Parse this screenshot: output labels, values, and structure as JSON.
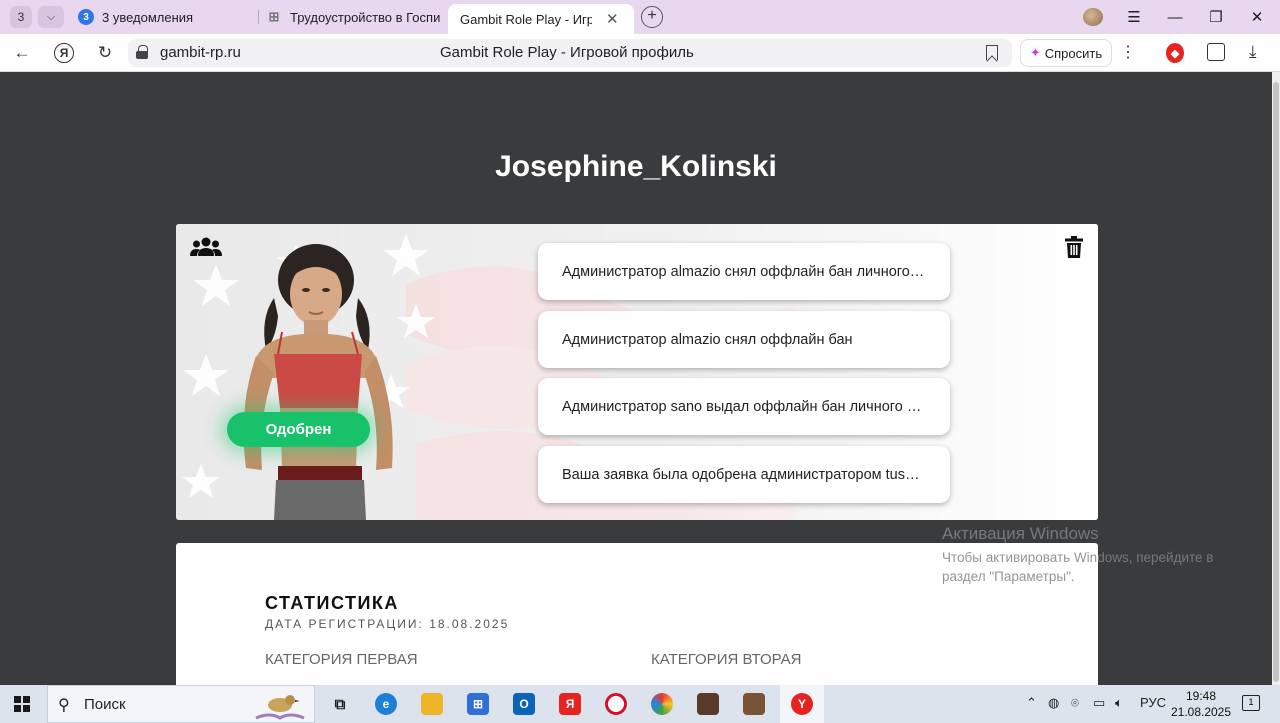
{
  "browser": {
    "tab_count": "3",
    "tabs": [
      {
        "label": "3 уведомления",
        "badge": "3"
      },
      {
        "label": "Трудоустройство в Госпи"
      },
      {
        "label": "Gambit Role Play - Игровой профиль"
      }
    ],
    "url": "gambit-rp.ru",
    "page_title": "Gambit Role Play - Игровой профиль",
    "ask_label": "Спросить"
  },
  "profile": {
    "username": "Josephine_Kolinski",
    "status": "Одобрен",
    "notifications": [
      "Администратор almazio снял оффлайн бан личного…",
      "Администратор almazio снял оффлайн бан",
      "Администратор sano выдал оффлайн бан личного …",
      "Ваша заявка была одобрена администратором tus…"
    ]
  },
  "stats": {
    "title": "СТАТИСТИКА",
    "registration": "ДАТА РЕГИСТРАЦИИ: 18.08.2025",
    "category_first": "КАТЕГОРИЯ ПЕРВАЯ",
    "category_second": "КАТЕГОРИЯ ВТОРАЯ"
  },
  "watermark": {
    "title": "Активация Windows",
    "text": "Чтобы активировать Windows, перейдите в раздел \"Параметры\"."
  },
  "taskbar": {
    "search_label": "Поиск",
    "language": "РУС",
    "time": "19:48",
    "date": "21.08.2025",
    "notification_count": "1"
  }
}
